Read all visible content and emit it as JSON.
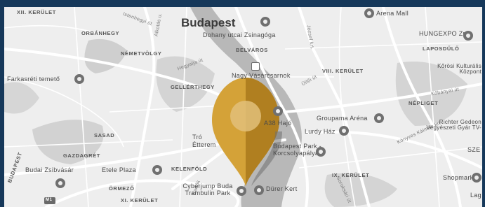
{
  "map": {
    "city": "Budapest",
    "districts": [
      "XII. KERÜLET",
      "ORBÁNHEGY",
      "NÉMETVÖLGY",
      "BELVÁROS",
      "VIII. KERÜLET",
      "GELLÉRTHEGY",
      "NÉPLIGET",
      "SASAD",
      "GAZDAGRÉT",
      "KELENFÖLD",
      "ÖRMEZŐ",
      "IX. KERÜLET",
      "XI. KERÜLET",
      "BUDAPEST"
    ],
    "places": [
      "Dohany utcai Zsinagóga",
      "Nagy Vásárcsarnok",
      "Farkasréti temető",
      "Arena Mall",
      "HUNGEXPO Zrt",
      "LAPOSDŰLŐ",
      "Kőrösi Kulturális Központ",
      "Groupama Aréna",
      "Lurdy Ház",
      "Budapest Park - Korcsolyapálya",
      "Richter Gedeon Vegyészeti Gyár TV-",
      "SZE",
      "Shopmark",
      "Lag",
      "Budai Zsibvásár",
      "Etele Plaza",
      "Cyberjump Buda Trambulin Park",
      "Dürer Kert",
      "Tró Étterem",
      "A38 Hajó"
    ],
    "streets": [
      "Istenhegyi út",
      "Alkotás u.",
      "Hegyalja út",
      "Üllői út",
      "József krt.",
      "Kőbányai út",
      "Bartók",
      "Soroksári út",
      "Könyves Kálmán krt."
    ],
    "highway_badges": [
      "M1"
    ],
    "marker": {
      "color": "#d4a238",
      "selected": true
    }
  }
}
